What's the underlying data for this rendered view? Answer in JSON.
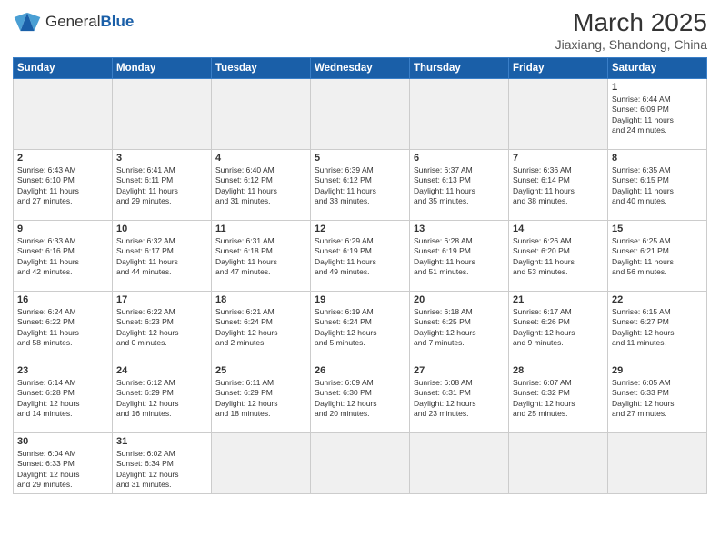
{
  "logo": {
    "text_general": "General",
    "text_blue": "Blue"
  },
  "title": {
    "month_year": "March 2025",
    "location": "Jiaxiang, Shandong, China"
  },
  "weekdays": [
    "Sunday",
    "Monday",
    "Tuesday",
    "Wednesday",
    "Thursday",
    "Friday",
    "Saturday"
  ],
  "weeks": [
    [
      {
        "day": "",
        "info": "",
        "empty": true
      },
      {
        "day": "",
        "info": "",
        "empty": true
      },
      {
        "day": "",
        "info": "",
        "empty": true
      },
      {
        "day": "",
        "info": "",
        "empty": true
      },
      {
        "day": "",
        "info": "",
        "empty": true
      },
      {
        "day": "",
        "info": "",
        "empty": true
      },
      {
        "day": "1",
        "info": "Sunrise: 6:44 AM\nSunset: 6:09 PM\nDaylight: 11 hours\nand 24 minutes."
      }
    ],
    [
      {
        "day": "2",
        "info": "Sunrise: 6:43 AM\nSunset: 6:10 PM\nDaylight: 11 hours\nand 27 minutes."
      },
      {
        "day": "3",
        "info": "Sunrise: 6:41 AM\nSunset: 6:11 PM\nDaylight: 11 hours\nand 29 minutes."
      },
      {
        "day": "4",
        "info": "Sunrise: 6:40 AM\nSunset: 6:12 PM\nDaylight: 11 hours\nand 31 minutes."
      },
      {
        "day": "5",
        "info": "Sunrise: 6:39 AM\nSunset: 6:12 PM\nDaylight: 11 hours\nand 33 minutes."
      },
      {
        "day": "6",
        "info": "Sunrise: 6:37 AM\nSunset: 6:13 PM\nDaylight: 11 hours\nand 35 minutes."
      },
      {
        "day": "7",
        "info": "Sunrise: 6:36 AM\nSunset: 6:14 PM\nDaylight: 11 hours\nand 38 minutes."
      },
      {
        "day": "8",
        "info": "Sunrise: 6:35 AM\nSunset: 6:15 PM\nDaylight: 11 hours\nand 40 minutes."
      }
    ],
    [
      {
        "day": "9",
        "info": "Sunrise: 6:33 AM\nSunset: 6:16 PM\nDaylight: 11 hours\nand 42 minutes."
      },
      {
        "day": "10",
        "info": "Sunrise: 6:32 AM\nSunset: 6:17 PM\nDaylight: 11 hours\nand 44 minutes."
      },
      {
        "day": "11",
        "info": "Sunrise: 6:31 AM\nSunset: 6:18 PM\nDaylight: 11 hours\nand 47 minutes."
      },
      {
        "day": "12",
        "info": "Sunrise: 6:29 AM\nSunset: 6:19 PM\nDaylight: 11 hours\nand 49 minutes."
      },
      {
        "day": "13",
        "info": "Sunrise: 6:28 AM\nSunset: 6:19 PM\nDaylight: 11 hours\nand 51 minutes."
      },
      {
        "day": "14",
        "info": "Sunrise: 6:26 AM\nSunset: 6:20 PM\nDaylight: 11 hours\nand 53 minutes."
      },
      {
        "day": "15",
        "info": "Sunrise: 6:25 AM\nSunset: 6:21 PM\nDaylight: 11 hours\nand 56 minutes."
      }
    ],
    [
      {
        "day": "16",
        "info": "Sunrise: 6:24 AM\nSunset: 6:22 PM\nDaylight: 11 hours\nand 58 minutes."
      },
      {
        "day": "17",
        "info": "Sunrise: 6:22 AM\nSunset: 6:23 PM\nDaylight: 12 hours\nand 0 minutes."
      },
      {
        "day": "18",
        "info": "Sunrise: 6:21 AM\nSunset: 6:24 PM\nDaylight: 12 hours\nand 2 minutes."
      },
      {
        "day": "19",
        "info": "Sunrise: 6:19 AM\nSunset: 6:24 PM\nDaylight: 12 hours\nand 5 minutes."
      },
      {
        "day": "20",
        "info": "Sunrise: 6:18 AM\nSunset: 6:25 PM\nDaylight: 12 hours\nand 7 minutes."
      },
      {
        "day": "21",
        "info": "Sunrise: 6:17 AM\nSunset: 6:26 PM\nDaylight: 12 hours\nand 9 minutes."
      },
      {
        "day": "22",
        "info": "Sunrise: 6:15 AM\nSunset: 6:27 PM\nDaylight: 12 hours\nand 11 minutes."
      }
    ],
    [
      {
        "day": "23",
        "info": "Sunrise: 6:14 AM\nSunset: 6:28 PM\nDaylight: 12 hours\nand 14 minutes."
      },
      {
        "day": "24",
        "info": "Sunrise: 6:12 AM\nSunset: 6:29 PM\nDaylight: 12 hours\nand 16 minutes."
      },
      {
        "day": "25",
        "info": "Sunrise: 6:11 AM\nSunset: 6:29 PM\nDaylight: 12 hours\nand 18 minutes."
      },
      {
        "day": "26",
        "info": "Sunrise: 6:09 AM\nSunset: 6:30 PM\nDaylight: 12 hours\nand 20 minutes."
      },
      {
        "day": "27",
        "info": "Sunrise: 6:08 AM\nSunset: 6:31 PM\nDaylight: 12 hours\nand 23 minutes."
      },
      {
        "day": "28",
        "info": "Sunrise: 6:07 AM\nSunset: 6:32 PM\nDaylight: 12 hours\nand 25 minutes."
      },
      {
        "day": "29",
        "info": "Sunrise: 6:05 AM\nSunset: 6:33 PM\nDaylight: 12 hours\nand 27 minutes."
      }
    ],
    [
      {
        "day": "30",
        "info": "Sunrise: 6:04 AM\nSunset: 6:33 PM\nDaylight: 12 hours\nand 29 minutes."
      },
      {
        "day": "31",
        "info": "Sunrise: 6:02 AM\nSunset: 6:34 PM\nDaylight: 12 hours\nand 31 minutes."
      },
      {
        "day": "",
        "info": "",
        "empty": true
      },
      {
        "day": "",
        "info": "",
        "empty": true
      },
      {
        "day": "",
        "info": "",
        "empty": true
      },
      {
        "day": "",
        "info": "",
        "empty": true
      },
      {
        "day": "",
        "info": "",
        "empty": true
      }
    ]
  ]
}
